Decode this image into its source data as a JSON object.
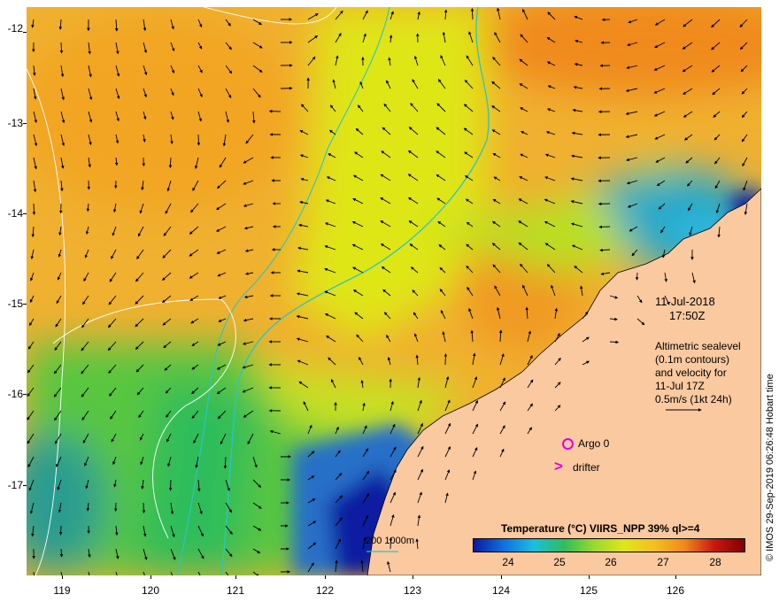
{
  "axes": {
    "y_ticks": [
      "-12",
      "-13",
      "-14",
      "-15",
      "-16",
      "-17"
    ],
    "x_ticks": [
      "119",
      "120",
      "121",
      "122",
      "123",
      "124",
      "125",
      "126"
    ]
  },
  "annotations": {
    "date": "11-Jul-2018",
    "time": "17:50Z",
    "altimetry_lines": [
      "Altimetric sealevel",
      "(0.1m contours)",
      "and velocity for",
      "11-Jul 17Z",
      "0.5m/s (1kt 24h)"
    ],
    "argo_label": "Argo 0",
    "drifter_label": "drifter",
    "bathy_label": "200  1000m"
  },
  "colorbar": {
    "title": "Temperature (°C) VIIRS_NPP 39% ql>=4",
    "ticks": [
      "24",
      "25",
      "26",
      "27",
      "28"
    ]
  },
  "credit": "© IMOS 29-Sep-2019 06:26:48 Hobart time",
  "colors": {
    "land": "#fac9a0",
    "warm": "#f2a524",
    "mid": "#dfe619",
    "cool": "#2fbd5a",
    "cold": "#0a1aa0",
    "bathy": "#28c6c6",
    "markers": "#e000e0"
  }
}
